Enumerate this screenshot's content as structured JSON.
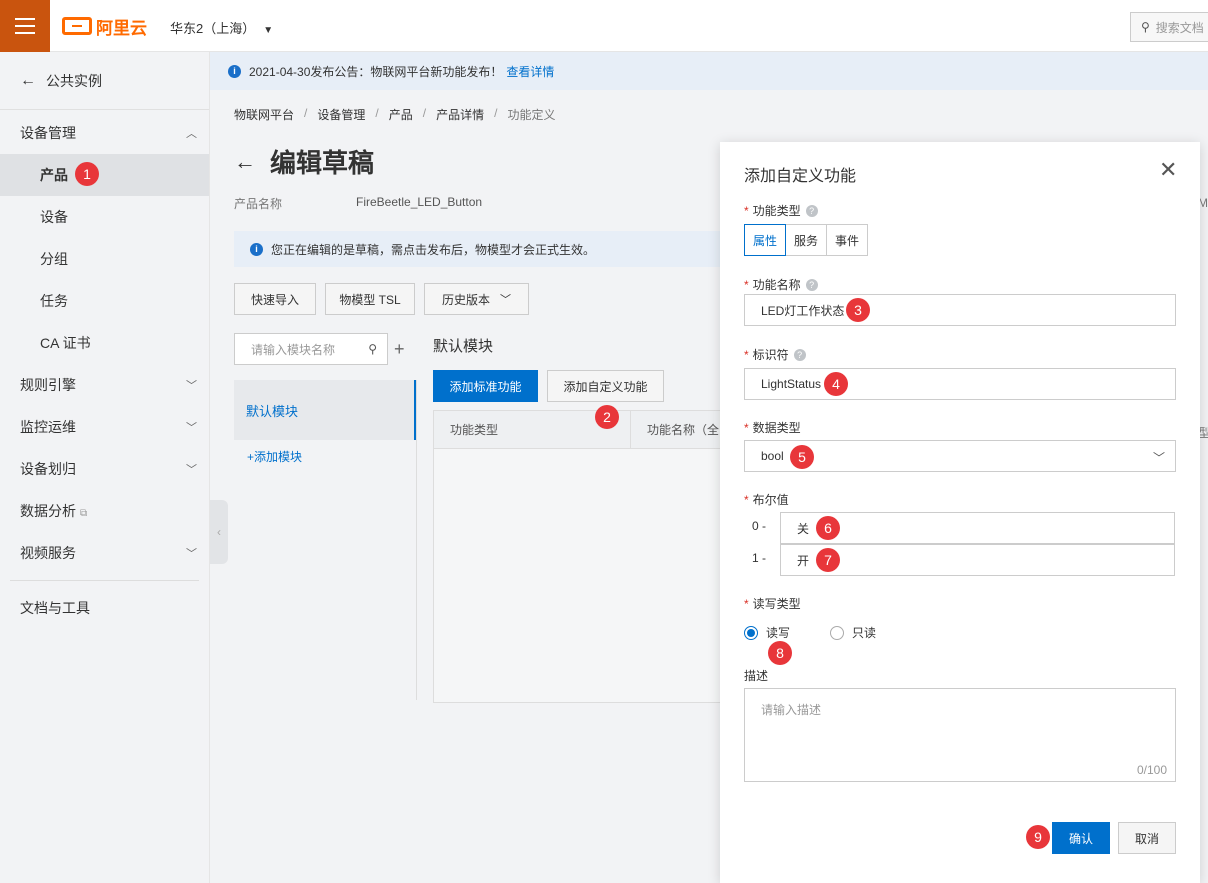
{
  "topbar": {
    "brand": "阿里云",
    "region": "华东2（上海）",
    "search_placeholder": "搜索文档"
  },
  "notice": {
    "text": "2021-04-30发布公告：物联网平台新功能发布！",
    "link": "查看详情"
  },
  "sidebar": {
    "back_label": "公共实例",
    "group_device": "设备管理",
    "items": [
      "产品",
      "设备",
      "分组",
      "任务",
      "CA 证书"
    ],
    "groups": [
      "规则引擎",
      "监控运维",
      "设备划归",
      "数据分析",
      "视频服务"
    ],
    "docs": "文档与工具"
  },
  "breadcrumb": [
    "物联网平台",
    "设备管理",
    "产品",
    "产品详情",
    "功能定义"
  ],
  "page": {
    "title": "编辑草稿",
    "product_label": "产品名称",
    "product_name": "FireBeetle_LED_Button",
    "draft_tip": "您正在编辑的是草稿，需点击发布后，物模型才会正式生效。",
    "btn_quick_import": "快速导入",
    "btn_tsl": "物模型 TSL",
    "btn_history": "历史版本",
    "module_search_placeholder": "请输入模块名称",
    "module_default": "默认模块",
    "add_module": "+添加模块",
    "module_title": "默认模块",
    "btn_add_standard": "添加标准功能",
    "btn_add_custom": "添加自定义功能",
    "col_type": "功能类型",
    "col_name": "功能名称（全",
    "edge_m": "M",
    "edge_type": "型"
  },
  "modal": {
    "title": "添加自定义功能",
    "label_type": "功能类型",
    "type_options": [
      "属性",
      "服务",
      "事件"
    ],
    "label_name": "功能名称",
    "name_value": "LED灯工作状态",
    "label_identifier": "标识符",
    "identifier_value": "LightStatus",
    "label_datatype": "数据类型",
    "datatype_value": "bool",
    "label_bool": "布尔值",
    "bool_0_prefix": "0 -",
    "bool_0_value": "关",
    "bool_1_prefix": "1 -",
    "bool_1_value": "开",
    "label_rw": "读写类型",
    "rw_options": [
      "读写",
      "只读"
    ],
    "label_desc": "描述",
    "desc_placeholder": "请输入描述",
    "desc_counter": "0/100",
    "confirm": "确认",
    "cancel": "取消"
  },
  "steps": [
    "1",
    "2",
    "3",
    "4",
    "5",
    "6",
    "7",
    "8",
    "9"
  ],
  "colors": {
    "accent": "#0070cc",
    "brand": "#ff6a00",
    "step_marker": "#e8363a"
  }
}
